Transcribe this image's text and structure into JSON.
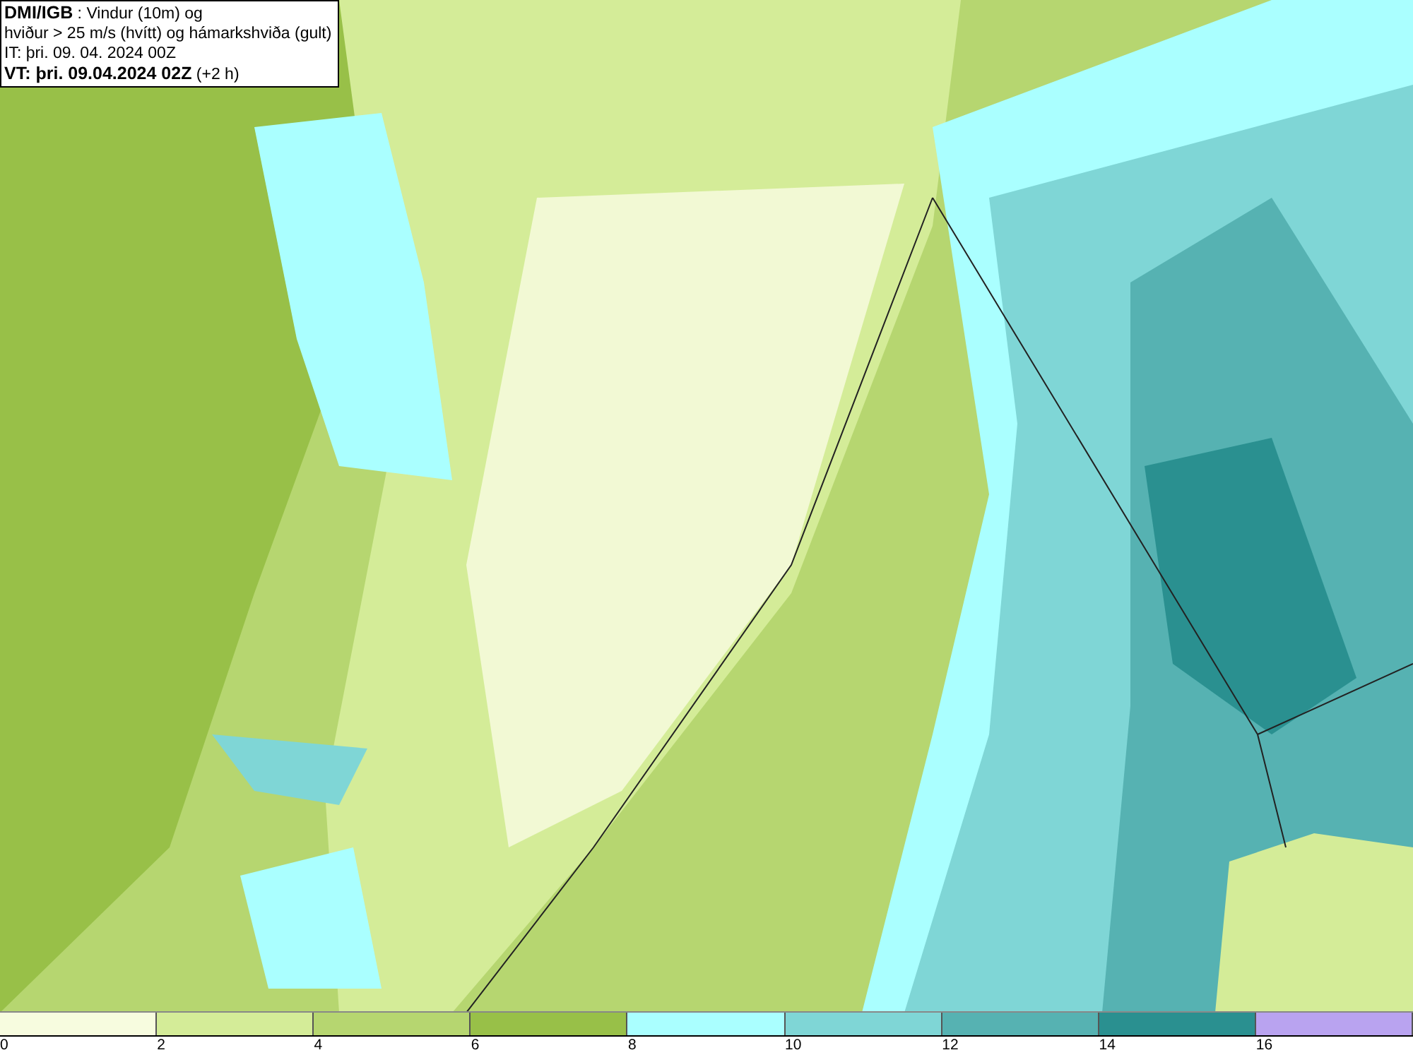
{
  "header": {
    "lines": [
      "**DMI/IGB** : Vindur (10m) og",
      "hviður > 25 m/s (hvítt) og hámarkshviða (gult)",
      "IT: þri. 09. 04. 2024 00Z",
      "**VT: þri. 09.04.2024 02Z** (+2 h)"
    ]
  },
  "legend": {
    "bins": [
      {
        "color": "#f7fcdf"
      },
      {
        "color": "#d4ec98"
      },
      {
        "color": "#b6d670"
      },
      {
        "color": "#98c048"
      },
      {
        "color": "#aaffff"
      },
      {
        "color": "#7fd6d6"
      },
      {
        "color": "#56b2b2"
      },
      {
        "color": "#2a9090"
      },
      {
        "color": "#b9a3f0"
      }
    ],
    "labels": [
      "0",
      "2",
      "4",
      "6",
      "8",
      "10",
      "12",
      "14",
      "16"
    ]
  }
}
